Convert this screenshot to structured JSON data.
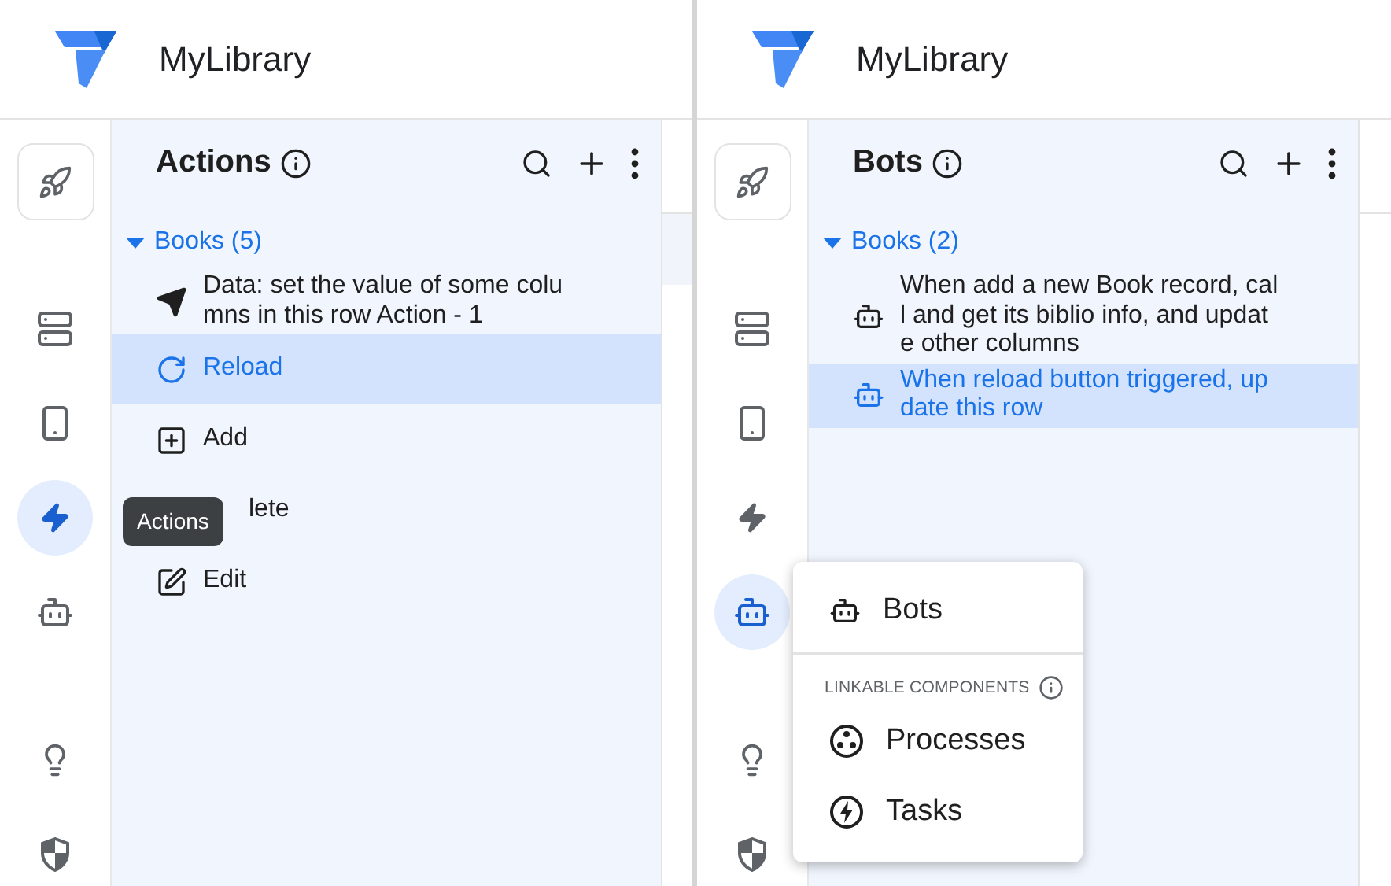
{
  "panes": [
    {
      "app_title": "MyLibrary",
      "rail": [
        [
          {
            "kind": "rocket",
            "selected": false
          }
        ],
        [
          {
            "kind": "table",
            "selected": false
          },
          {
            "kind": "phone",
            "selected": false
          },
          {
            "kind": "bolt",
            "selected": true
          },
          {
            "kind": "robot",
            "selected": false
          }
        ],
        [
          {
            "kind": "bulb",
            "selected": false
          },
          {
            "kind": "shield",
            "selected": false
          }
        ]
      ],
      "panel": {
        "title": "Actions",
        "group": {
          "label": "Books (5)",
          "expanded": true
        },
        "items": [
          {
            "kind": "send",
            "lines": [
              "Data: set the value of some colu",
              "mns in this row Action - 1"
            ],
            "selected": false
          },
          {
            "kind": "reload",
            "lines": [
              "Reload"
            ],
            "selected": true
          },
          {
            "kind": "add",
            "lines": [
              "Add"
            ],
            "selected": false
          },
          {
            "kind": "covered",
            "lines": [
              "lete"
            ],
            "selected": false
          },
          {
            "kind": "edit",
            "lines": [
              "Edit"
            ],
            "selected": false
          }
        ]
      },
      "content_row_highlight": true,
      "tooltip": {
        "text": "Actions"
      }
    },
    {
      "app_title": "MyLibrary",
      "rail": [
        [
          {
            "kind": "rocket",
            "selected": false
          }
        ],
        [
          {
            "kind": "table",
            "selected": false
          },
          {
            "kind": "phone",
            "selected": false
          },
          {
            "kind": "bolt",
            "selected": false
          },
          {
            "kind": "robot",
            "selected": true
          }
        ],
        [
          {
            "kind": "bulb",
            "selected": false
          },
          {
            "kind": "shield",
            "selected": false
          }
        ]
      ],
      "panel": {
        "title": "Bots",
        "group": {
          "label": "Books (2)",
          "expanded": true
        },
        "items": [
          {
            "kind": "robot",
            "lines": [
              "When add a new Book record, cal",
              "l and get its biblio info, and updat",
              "e other columns"
            ],
            "selected": false
          },
          {
            "kind": "robot",
            "lines": [
              "When reload button triggered, up",
              "date this row"
            ],
            "selected": true
          }
        ]
      },
      "menu": {
        "items": [
          {
            "kind": "robot",
            "label": "Bots"
          }
        ],
        "section": "LINKABLE COMPONENTS",
        "linked": [
          {
            "kind": "processes",
            "label": "Processes"
          },
          {
            "kind": "tasks",
            "label": "Tasks"
          }
        ]
      }
    }
  ]
}
